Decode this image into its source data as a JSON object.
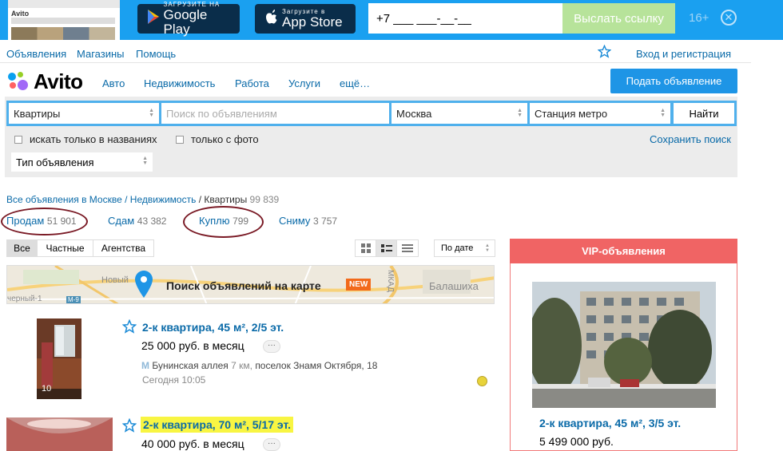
{
  "banner": {
    "google_small": "ЗАГРУЗИТЕ НА",
    "google_big": "Google Play",
    "apple_small": "Загрузите в",
    "apple_big": "App Store",
    "phone_value": "+7 ___ ___-__-__",
    "send_label": "Выслать ссылку",
    "age": "16+",
    "phone_logo": "Avito",
    "icons": [
      "play-icon",
      "apple-icon",
      "close-icon"
    ],
    "color": "#1aa0f0"
  },
  "topnav": {
    "items": [
      "Объявления",
      "Магазины",
      "Помощь"
    ],
    "login": "Вход и регистрация"
  },
  "header": {
    "logo": "Avito",
    "categories": [
      "Авто",
      "Недвижимость",
      "Работа",
      "Услуги",
      "ещё…"
    ],
    "post_ad": "Подать объявление",
    "accent": "#1e95e6"
  },
  "search": {
    "category": "Квартиры",
    "query_placeholder": "Поиск по объявлениям",
    "city": "Москва",
    "metro": "Станция метро",
    "find": "Найти",
    "only_titles": "искать только в названиях",
    "only_photo": "только с фото",
    "save": "Сохранить поиск",
    "ad_type": "Тип объявления"
  },
  "breadcrumb": {
    "all": "Все объявления в Москве",
    "sep1": " / ",
    "realty": "Недвижимость",
    "sep2": " / ",
    "current": "Квартиры",
    "count": "99 839"
  },
  "deals": [
    {
      "label": "Продам",
      "count": "51 901"
    },
    {
      "label": "Сдам",
      "count": "43 382"
    },
    {
      "label": "Куплю",
      "count": "799"
    },
    {
      "label": "Сниму",
      "count": "3 757"
    }
  ],
  "filter": {
    "tabs": [
      "Все",
      "Частные",
      "Агентства"
    ],
    "sort": "По дате",
    "views": [
      "grid-view-icon",
      "list-view-icon",
      "compact-view-icon"
    ]
  },
  "map": {
    "text": "Поиск объявлений на карте",
    "badge": "NEW",
    "labels": [
      "Новый",
      "МКАД",
      "Балашиха",
      "черный-1",
      "М-9"
    ]
  },
  "listings": [
    {
      "title": "2-к квартира, 45 м², 2/5 эт.",
      "price": "25 000 руб. в месяц",
      "address": "Бунинская аллея",
      "distance": "7 км,",
      "address2": "поселок Знамя Октября, 18",
      "date": "Сегодня 10:05",
      "photos": "10"
    },
    {
      "title": "2-к квартира, 70 м², 5/17 эт.",
      "price": "40 000 руб. в месяц"
    }
  ],
  "more_label": "···",
  "vip": {
    "header": "VIP-объявления",
    "title": "2-к квартира, 45 м², 3/5 эт.",
    "price": "5 499 000 руб.",
    "color": "#f06464"
  }
}
